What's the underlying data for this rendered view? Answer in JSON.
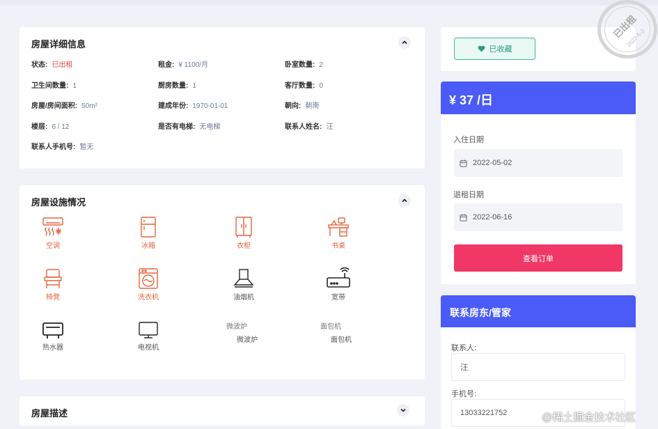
{
  "detail": {
    "title": "房屋详细信息",
    "items": [
      {
        "k": "状态:",
        "v": "已出租",
        "red": true
      },
      {
        "k": "租金:",
        "v": "¥ 1100/月"
      },
      {
        "k": "卧室数量:",
        "v": "2"
      },
      {
        "k": "卫生间数量:",
        "v": "1"
      },
      {
        "k": "厨房数量:",
        "v": "1"
      },
      {
        "k": "客厅数量:",
        "v": "0"
      },
      {
        "k": "房屋/房间面积:",
        "v": "50m²"
      },
      {
        "k": "建成年份:",
        "v": "1970-01-01"
      },
      {
        "k": "朝向:",
        "v": "朝南"
      },
      {
        "k": "楼层:",
        "v": "6 / 12"
      },
      {
        "k": "是否有电梯:",
        "v": "无电梯"
      },
      {
        "k": "联系人姓名:",
        "v": "汪"
      },
      {
        "k": "联系人手机号:",
        "v": "暂无"
      }
    ]
  },
  "facilities": {
    "title": "房屋设施情况",
    "items": [
      {
        "label": "空调",
        "icon": "air-conditioner-icon"
      },
      {
        "label": "冰箱",
        "icon": "fridge-icon"
      },
      {
        "label": "衣柜",
        "icon": "wardrobe-icon"
      },
      {
        "label": "书桌",
        "icon": "desk-icon"
      },
      {
        "label": "椅凳",
        "icon": "chair-icon"
      },
      {
        "label": "洗衣机",
        "icon": "washer-icon"
      },
      {
        "label": "油烟机",
        "icon": "range-hood-icon"
      },
      {
        "label": "宽带",
        "icon": "router-icon"
      },
      {
        "label": "热水器",
        "icon": "water-heater-icon"
      },
      {
        "label": "电视机",
        "icon": "tv-icon"
      },
      {
        "label": "微波炉",
        "alt": "微波炉"
      },
      {
        "label": "面包机",
        "alt": "面包机"
      }
    ]
  },
  "description": {
    "title": "房屋描述"
  },
  "favorite": {
    "label": "已收藏"
  },
  "stamp": {
    "text": "已出租",
    "date": "2022-5-2"
  },
  "booking": {
    "price": "¥ 37 /日",
    "checkin_label": "入住日期",
    "checkin_value": "2022-05-02",
    "checkout_label": "退租日期",
    "checkout_value": "2022-06-16",
    "order_button": "查看订单"
  },
  "contact": {
    "title": "联系房东/管家",
    "name_label": "联系人:",
    "name_value": "汪",
    "phone_label": "手机号:",
    "phone_value": "13033221752"
  },
  "watermark": "@稀土掘金技术社区",
  "colors": {
    "accent": "#4a5bf7",
    "danger": "#f03766",
    "facility_on": "#e8643c",
    "favorite": "#3cb899"
  }
}
